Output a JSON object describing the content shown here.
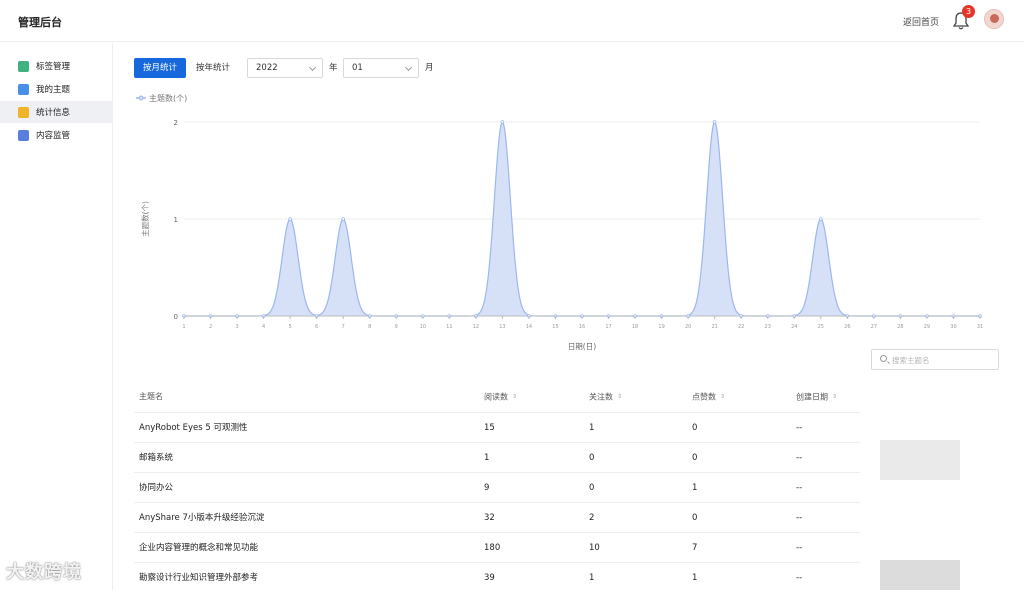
{
  "header": {
    "title": "管理后台",
    "home_link": "返回首页",
    "notification_count": "3"
  },
  "sidebar": {
    "items": [
      {
        "label": "标签管理",
        "icon": "tag-icon",
        "color": "#3fb27f",
        "active": false
      },
      {
        "label": "我的主题",
        "icon": "topic-icon",
        "color": "#4a8fe7",
        "active": false
      },
      {
        "label": "统计信息",
        "icon": "stats-icon",
        "color": "#f0b429",
        "active": true
      },
      {
        "label": "内容监管",
        "icon": "shield-icon",
        "color": "#5b7fe0",
        "active": false
      }
    ]
  },
  "toolbar": {
    "by_month": "按月统计",
    "by_year": "按年统计",
    "year_value": "2022",
    "year_unit": "年",
    "month_value": "01",
    "month_unit": "月"
  },
  "chart_data": {
    "type": "area",
    "legend": "主题数(个)",
    "ylabel": "主题数(个)",
    "xlabel": "日期(日)",
    "ylim": [
      0,
      2
    ],
    "yticks": [
      0,
      1,
      2
    ],
    "x": [
      1,
      2,
      3,
      4,
      5,
      6,
      7,
      8,
      9,
      10,
      11,
      12,
      13,
      14,
      15,
      16,
      17,
      18,
      19,
      20,
      21,
      22,
      23,
      24,
      25,
      26,
      27,
      28,
      29,
      30,
      31
    ],
    "series": [
      {
        "name": "主题数(个)",
        "values": [
          0,
          0,
          0,
          0,
          1,
          0,
          1,
          0,
          0,
          0,
          0,
          0,
          2,
          0,
          0,
          0,
          0,
          0,
          0,
          0,
          2,
          0,
          0,
          0,
          1,
          0,
          0,
          0,
          0,
          0,
          0
        ]
      }
    ],
    "colors": {
      "fill": "#cfdcf7",
      "stroke": "#9bb7ee",
      "grid": "#ececec"
    }
  },
  "search": {
    "placeholder": "搜索主题名"
  },
  "table": {
    "columns": [
      "主题名",
      "阅读数",
      "关注数",
      "点赞数",
      "创建日期"
    ],
    "rows": [
      [
        "AnyRobot Eyes 5 可观测性",
        "15",
        "1",
        "0",
        "--"
      ],
      [
        "邮箱系统",
        "1",
        "0",
        "0",
        "--"
      ],
      [
        "协同办公",
        "9",
        "0",
        "1",
        "--"
      ],
      [
        "AnyShare 7小版本升级经验沉淀",
        "32",
        "2",
        "0",
        "--"
      ],
      [
        "企业内容管理的概念和常见功能",
        "180",
        "10",
        "7",
        "--"
      ],
      [
        "勘察设计行业知识管理外部参考",
        "39",
        "1",
        "1",
        "--"
      ]
    ]
  },
  "watermark": "大数跨境"
}
